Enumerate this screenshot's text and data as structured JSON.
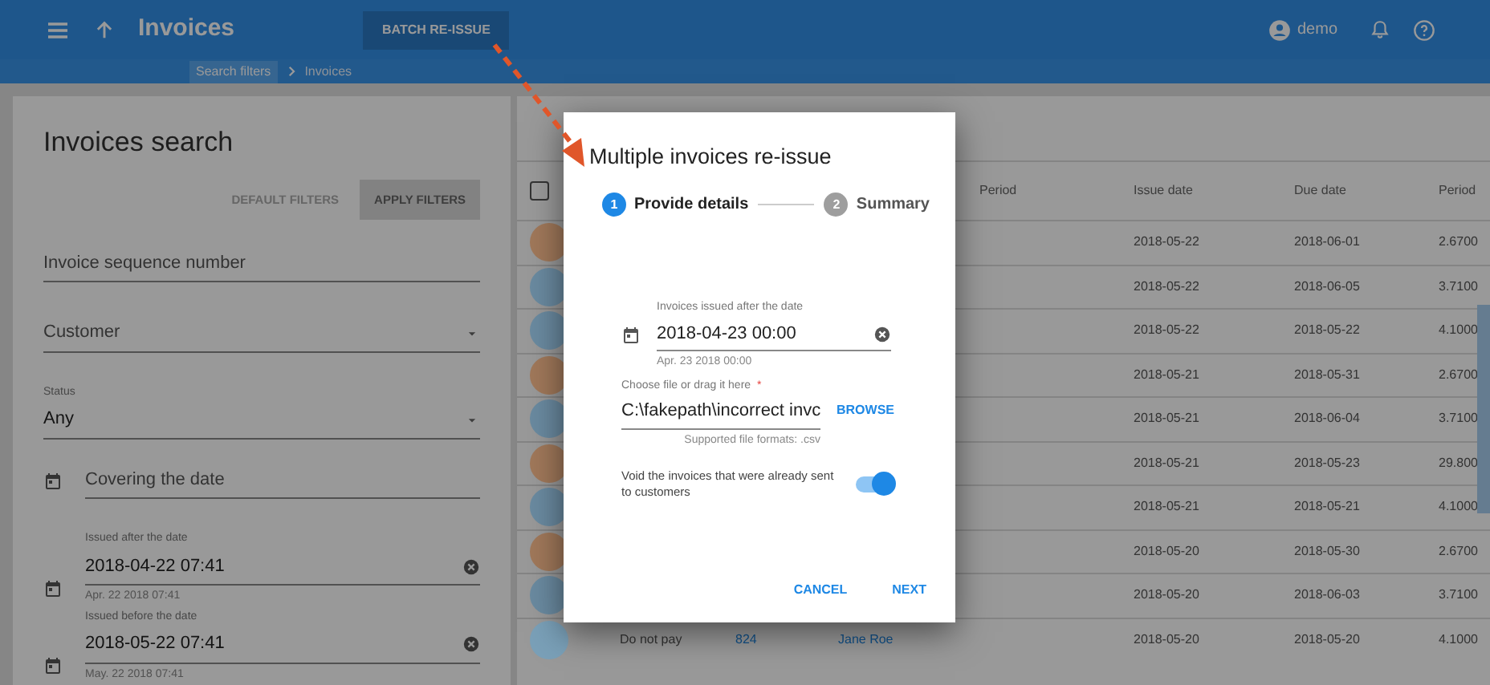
{
  "topbar": {
    "title": "Invoices",
    "action_button": "BATCH RE-ISSUE",
    "user": "demo"
  },
  "breadcrumbs": [
    "Search filters",
    "Invoices"
  ],
  "search_panel": {
    "title": "Invoices search",
    "buttons": [
      "DEFAULT FILTERS",
      "APPLY FILTERS"
    ],
    "fields": [
      {
        "kind": "text",
        "placeholder": "Invoice sequence number"
      },
      {
        "kind": "select",
        "placeholder": "Customer"
      },
      {
        "kind": "select",
        "label": "Status",
        "value": "Any"
      },
      {
        "kind": "date",
        "placeholder": "Covering the date"
      },
      {
        "kind": "date",
        "label": "Issued after the date",
        "value": "2018-04-22 07:41",
        "helper": "Apr. 22 2018 07:41",
        "clearable": true
      },
      {
        "kind": "date",
        "label": "Issued before the date",
        "value": "2018-05-22 07:41",
        "helper": "May. 22 2018 07:41",
        "clearable": true
      }
    ]
  },
  "table": {
    "header": {
      "checked": false,
      "column_5": "Period",
      "column_6": "Issue date",
      "column_7": "Due date",
      "column_8": "Period"
    },
    "rows": [
      {
        "color": "#a0785a",
        "column_6": "2018-05-22",
        "column_7": "2018-06-01",
        "column_8": "2.6700"
      },
      {
        "color": "#6a8aa0",
        "column_6": "2018-05-22",
        "column_7": "2018-06-05",
        "column_8": "3.7100"
      },
      {
        "color": "#6a8aa0",
        "column_6": "2018-05-22",
        "column_7": "2018-05-22",
        "column_8": "4.1000"
      },
      {
        "color": "#a0785a",
        "column_6": "2018-05-21",
        "column_7": "2018-05-31",
        "column_8": "2.6700"
      },
      {
        "color": "#6a8aa0",
        "column_6": "2018-05-21",
        "column_7": "2018-06-04",
        "column_8": "3.7100"
      },
      {
        "color": "#a0785a",
        "column_6": "2018-05-21",
        "column_7": "2018-05-23",
        "column_8": "29.800"
      },
      {
        "color": "#6a8aa0",
        "column_6": "2018-05-21",
        "column_7": "2018-05-21",
        "column_8": "4.1000"
      },
      {
        "color": "#a0785a",
        "column_6": "2018-05-20",
        "column_7": "2018-05-30",
        "column_8": "2.6700"
      },
      {
        "color": "#6a8aa0",
        "column_6": "2018-05-20",
        "column_7": "2018-06-03",
        "column_8": "3.7100"
      },
      {
        "color": "#7aa0b8",
        "column_2": "Do not pay",
        "column_3": "824",
        "column_4": "Jane Roe",
        "column_6": "2018-05-20",
        "column_7": "2018-05-20",
        "column_8": "4.1000"
      }
    ]
  },
  "dialog": {
    "title": "Multiple invoices re-issue",
    "steps": [
      {
        "number": "1",
        "label": "Provide details",
        "selected": true
      },
      {
        "number": "2",
        "label": "Summary",
        "selected": false
      }
    ],
    "date_field": {
      "label": "Invoices issued after the date",
      "value": "2018-04-23 00:00",
      "helper": "Apr. 23 2018 00:00"
    },
    "file_field": {
      "label": "Choose file or drag it here",
      "required_mark": "*",
      "value": "C:\\fakepath\\incorrect invc",
      "button": "BROWSE",
      "helper": "Supported file formats: .csv"
    },
    "void_switch": {
      "label": "Void the invoices that were already sent to customers",
      "on": true
    },
    "buttons": [
      "CANCEL",
      "NEXT"
    ]
  }
}
